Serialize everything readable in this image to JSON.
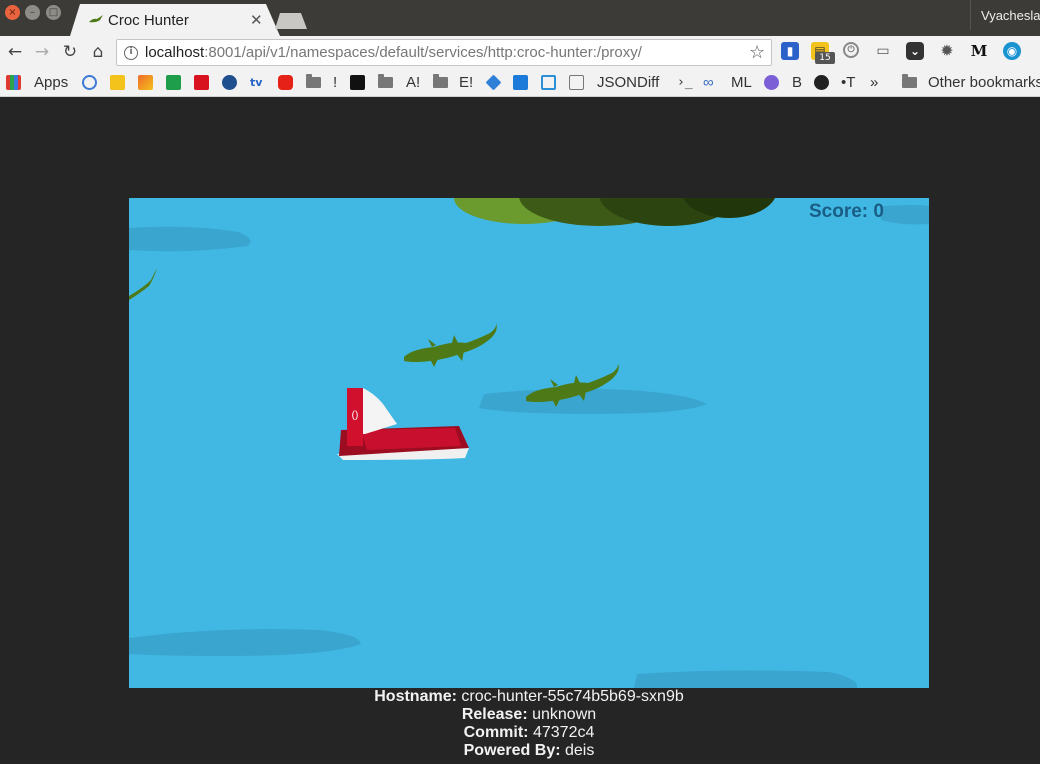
{
  "window": {
    "tab_title": "Croc Hunter",
    "tab_close": "✕",
    "user": "Vyacheslav"
  },
  "toolbar": {
    "url_host": "localhost",
    "url_rest": ":8001/api/v1/namespaces/default/services/http:croc-hunter:/proxy/",
    "extension_badge": "15"
  },
  "bookmarks": {
    "apps": "Apps",
    "items": [
      "!",
      "A!",
      "E!",
      "JSONDiff",
      "ML",
      "B",
      "•T"
    ],
    "more": "»",
    "other": "Other bookmarks"
  },
  "game": {
    "score_label": "Score: 0"
  },
  "info": {
    "hostname_label": "Hostname:",
    "hostname": "croc-hunter-55c74b5b69-sxn9b",
    "release_label": "Release:",
    "release": "unknown",
    "commit_label": "Commit:",
    "commit": "47372c4",
    "powered_label": "Powered By:",
    "powered": "deis"
  },
  "colors": {
    "water": "#41b8e4",
    "croc": "#4d7a16",
    "boat_red": "#c8102e",
    "score_text": "#1a5d85"
  }
}
